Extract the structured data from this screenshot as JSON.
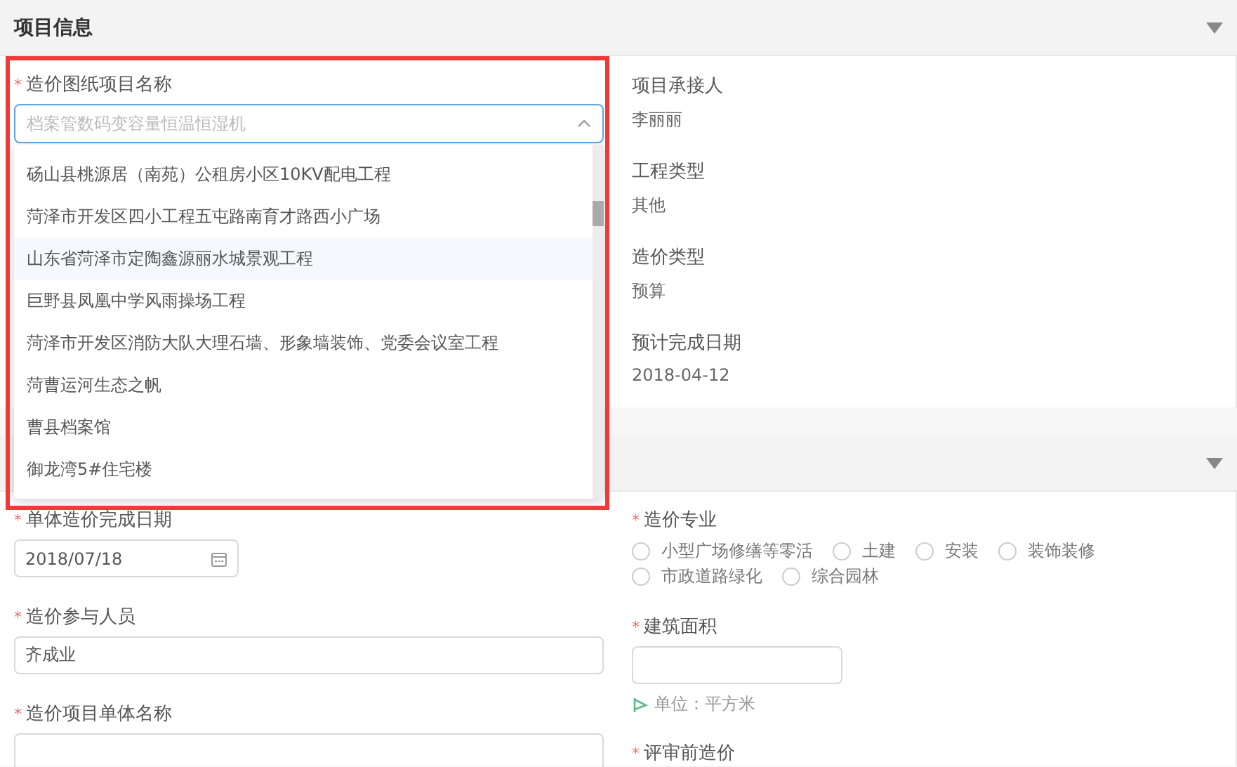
{
  "section_1": {
    "title": "项目信息",
    "select_field": {
      "label": "造价图纸项目名称",
      "mark": "*",
      "placeholder": "档案管数码变容量恒温恒湿机",
      "open": true,
      "options": [
        {
          "label": "砀山县桃源居（南苑）公租房小区10KV配电工程",
          "hovered": false
        },
        {
          "label": "菏泽市开发区四小工程五屯路南育才路西小广场",
          "hovered": false
        },
        {
          "label": "山东省菏泽市定陶鑫源丽水城景观工程",
          "hovered": true
        },
        {
          "label": "巨野县凤凰中学风雨操场工程",
          "hovered": false
        },
        {
          "label": "菏泽市开发区消防大队大理石墙、形象墙装饰、党委会议室工程",
          "hovered": false
        },
        {
          "label": "菏曹运河生态之帆",
          "hovered": false
        },
        {
          "label": "曹县档案馆",
          "hovered": false
        },
        {
          "label": "御龙湾5#住宅楼",
          "hovered": false
        }
      ]
    },
    "info": [
      {
        "label": "项目承接人",
        "value": "李丽丽"
      },
      {
        "label": "工程类型",
        "value": "其他"
      },
      {
        "label": "造价类型",
        "value": "预算"
      },
      {
        "label": "预计完成日期",
        "value": "2018-04-12"
      }
    ]
  },
  "section_2": {
    "left": [
      {
        "kind": "date",
        "label": "单体造价完成日期",
        "mark": "*",
        "value": "2018/07/18"
      },
      {
        "kind": "text",
        "label": "造价参与人员",
        "mark": "*",
        "value": "齐成业"
      },
      {
        "kind": "text",
        "label": "造价项目单体名称",
        "mark": "*"
      }
    ],
    "right": [
      {
        "kind": "radio",
        "label": "造价专业",
        "mark": "*",
        "options": [
          {
            "label": "小型广场修缮等零活",
            "selected": false
          },
          {
            "label": "土建",
            "selected": false
          },
          {
            "label": "安装",
            "selected": false
          },
          {
            "label": "装饰装修",
            "selected": false
          },
          {
            "label": "市政道路绿化",
            "selected": false
          },
          {
            "label": "综合园林",
            "selected": false
          }
        ]
      },
      {
        "kind": "number",
        "label": "建筑面积",
        "mark": "*",
        "hint": "单位：平方米"
      },
      {
        "kind": "heading",
        "label": "评审前造价",
        "mark": "*"
      }
    ]
  }
}
